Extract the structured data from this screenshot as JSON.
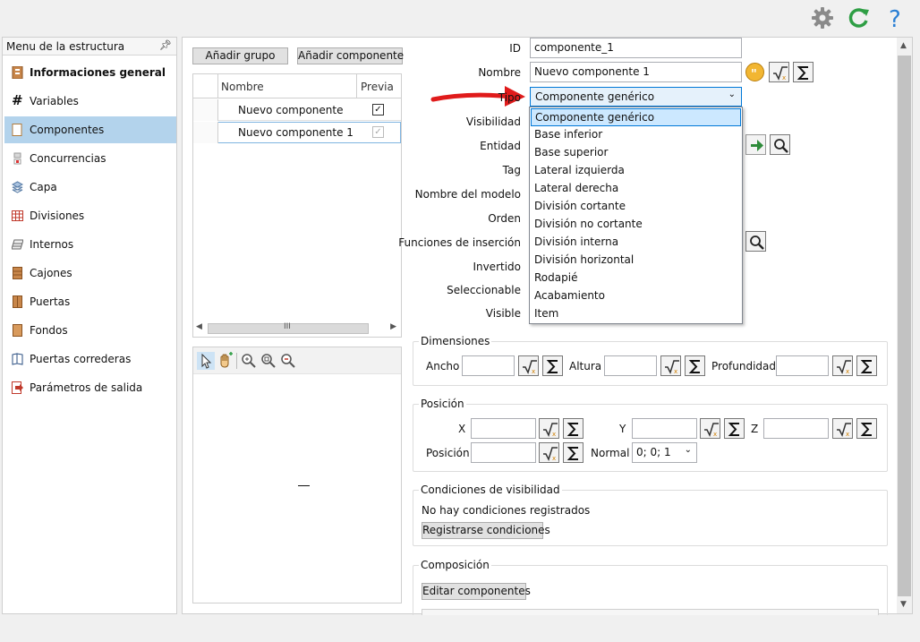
{
  "left_menu": {
    "title": "Menu de la estructura",
    "items": [
      {
        "label": "Informaciones general",
        "icon": "info-icon",
        "bold": true
      },
      {
        "label": "Variables",
        "icon": "hash-icon"
      },
      {
        "label": "Componentes",
        "icon": "component-icon",
        "active": true
      },
      {
        "label": "Concurrencias",
        "icon": "concurrence-icon"
      },
      {
        "label": "Capa",
        "icon": "layers-icon"
      },
      {
        "label": "Divisiones",
        "icon": "grid-icon"
      },
      {
        "label": "Internos",
        "icon": "shelves-icon"
      },
      {
        "label": "Cajones",
        "icon": "drawer-icon"
      },
      {
        "label": "Puertas",
        "icon": "door-icon"
      },
      {
        "label": "Fondos",
        "icon": "back-panel-icon"
      },
      {
        "label": "Puertas correderas",
        "icon": "sliding-door-icon"
      },
      {
        "label": "Parámetros de salida",
        "icon": "output-icon"
      }
    ]
  },
  "toolbar": {
    "add_group": "Añadir grupo",
    "add_component": "Añadir componente"
  },
  "component_grid": {
    "columns": [
      "Nombre",
      "Previa"
    ],
    "rows": [
      {
        "name": "Nuevo componente",
        "preview": true
      },
      {
        "name": "Nuevo componente 1",
        "preview": true
      }
    ],
    "scroll_grip": "III"
  },
  "form": {
    "id_label": "ID",
    "id_value": "componente_1",
    "nombre_label": "Nombre",
    "nombre_value": "Nuevo componente 1",
    "tipo_label": "Tipo",
    "tipo_value": "Componente genérico",
    "visibilidad_label": "Visibilidad",
    "entidad_label": "Entidad",
    "tag_label": "Tag",
    "nombre_modelo_label": "Nombre del modelo",
    "orden_label": "Orden",
    "funciones_label": "Funciones de inserción",
    "invertido_label": "Invertido",
    "seleccionable_label": "Seleccionable",
    "visible_label": "Visible"
  },
  "tipo_options": [
    "Componente genérico",
    "Base inferior",
    "Base superior",
    "Lateral izquierda",
    "Lateral derecha",
    "División cortante",
    "División no cortante",
    "División interna",
    "División horizontal",
    "Rodapié",
    "Acabamiento",
    "Item"
  ],
  "dimensiones": {
    "title": "Dimensiones",
    "ancho": "Ancho",
    "altura": "Altura",
    "profundidad": "Profundidad"
  },
  "posicion": {
    "title": "Posición",
    "x": "X",
    "y": "Y",
    "z": "Z",
    "posicion_label": "Posición",
    "normal_label": "Normal",
    "normal_value": "0; 0; 1"
  },
  "visibilidad_cond": {
    "title": "Condiciones de visibilidad",
    "empty": "No hay condiciones registrados",
    "button": "Registrarse condiciones"
  },
  "composicion": {
    "title": "Composición",
    "button": "Editar componentes"
  },
  "colors": {
    "accent": "#0078d7",
    "active_menu": "#b3d3ec",
    "refresh": "#2e9e44",
    "help": "#2a7fd4",
    "gear": "#8a8a8a",
    "annotation_arrow": "#e01b1b"
  }
}
